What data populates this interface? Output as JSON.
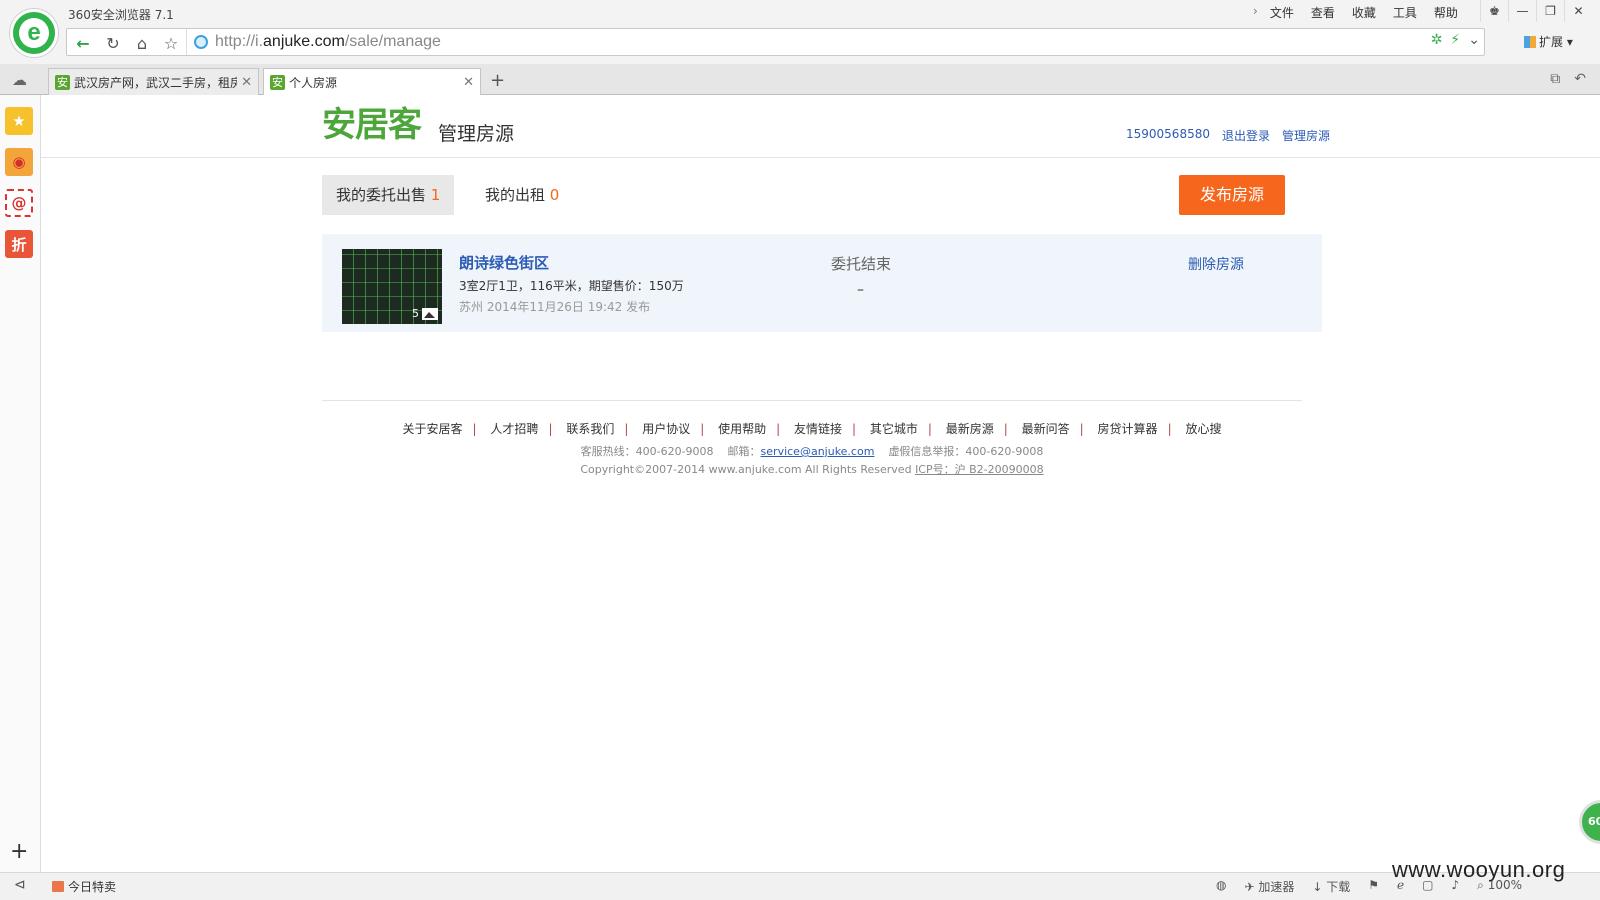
{
  "browser": {
    "title": "360安全浏览器 7.1",
    "menu": [
      "文件",
      "查看",
      "收藏",
      "工具",
      "帮助"
    ],
    "url_prefix": "http://i.",
    "url_host": "anjuke.com",
    "url_path": "/sale/manage",
    "extensions_label": "扩展",
    "tabs": [
      {
        "title": "武汉房产网，武汉二手房，租房",
        "favicon": "安"
      },
      {
        "title": "个人房源",
        "favicon": "安"
      }
    ],
    "sidebar_icons": [
      "star-icon",
      "weibo-icon",
      "mail-icon",
      "deal-icon"
    ],
    "status_bar": {
      "today_deal": "今日特卖",
      "accelerator": "加速器",
      "download": "下载",
      "zoom": "100%"
    },
    "float_badge": "60",
    "watermark": "www.wooyun.org"
  },
  "site": {
    "logo": "安居客",
    "page_title": "管理房源",
    "user_links": [
      "15900568580",
      "退出登录",
      "管理房源"
    ],
    "tabs": [
      {
        "label": "我的委托出售",
        "count": "1"
      },
      {
        "label": "我的出租",
        "count": "0"
      }
    ],
    "publish_button": "发布房源",
    "listing": {
      "name": "朗诗绿色街区",
      "desc": "3室2厅1卫，116平米，期望售价：150万",
      "meta": "苏州 2014年11月26日 19:42 发布",
      "photo_count": "5",
      "status": "委托结束",
      "status_detail": "–",
      "delete_label": "删除房源"
    },
    "footer": {
      "links": [
        "关于安居客",
        "人才招聘",
        "联系我们",
        "用户协议",
        "使用帮助",
        "友情链接",
        "其它城市",
        "最新房源",
        "最新问答",
        "房贷计算器",
        "放心搜"
      ],
      "hotline": "客服热线：400-620-9008",
      "mail_label": "邮箱：",
      "mail": "service@anjuke.com",
      "report": "虚假信息举报：400-620-9008",
      "copyright": "Copyright©2007-2014 www.anjuke.com All Rights Reserved",
      "icp": "ICP号：沪 B2-20090008"
    }
  },
  "colors": {
    "brand_green": "#4ca63a",
    "accent_orange": "#f6661c",
    "link_blue": "#2b5bb5"
  }
}
